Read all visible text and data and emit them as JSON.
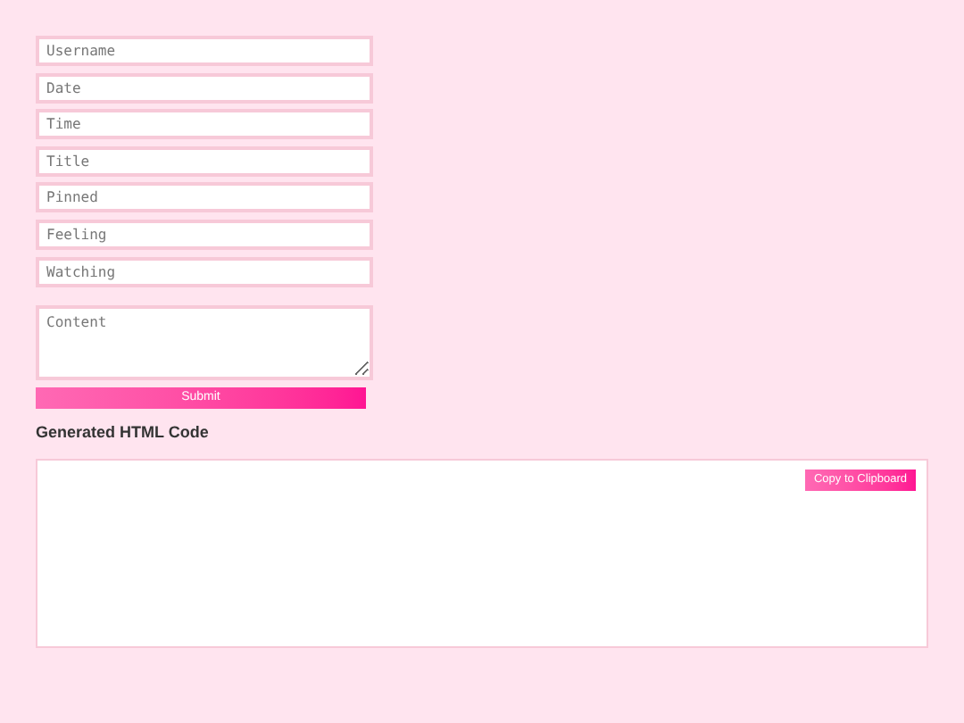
{
  "fields": [
    {
      "placeholder": "Username"
    },
    {
      "placeholder": "Date"
    },
    {
      "placeholder": "Time"
    },
    {
      "placeholder": "Title"
    },
    {
      "placeholder": "Pinned"
    },
    {
      "placeholder": "Feeling"
    },
    {
      "placeholder": "Watching"
    }
  ],
  "content": {
    "placeholder": "Content"
  },
  "submit": "Submit",
  "heading": "Generated HTML Code",
  "copy_button": "Copy to Clipboard"
}
